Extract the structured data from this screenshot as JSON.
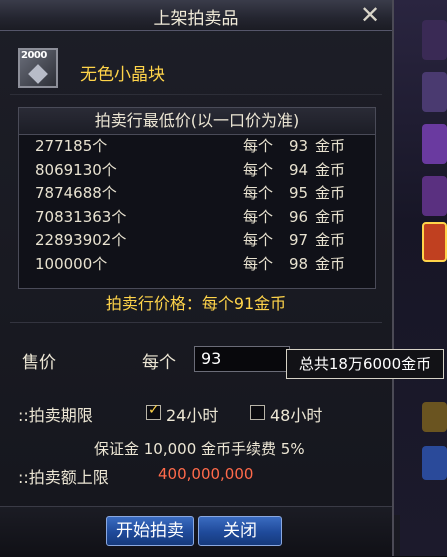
{
  "window": {
    "title": "上架拍卖品",
    "close_glyph": "✕"
  },
  "item": {
    "icon": "crystal-item-icon",
    "badge": "2000",
    "name": "无色小晶块"
  },
  "price_table": {
    "header": "拍卖行最低价(以一口价为准)",
    "rows": [
      {
        "qty": "277185个",
        "per": "每个",
        "price": "93",
        "unit": "金币"
      },
      {
        "qty": "8069130个",
        "per": "每个",
        "price": "94",
        "unit": "金币"
      },
      {
        "qty": "7874688个",
        "per": "每个",
        "price": "95",
        "unit": "金币"
      },
      {
        "qty": "70831363个",
        "per": "每个",
        "price": "96",
        "unit": "金币"
      },
      {
        "qty": "22893902个",
        "per": "每个",
        "price": "97",
        "unit": "金币"
      },
      {
        "qty": "100000个",
        "per": "每个",
        "price": "98",
        "unit": "金币"
      }
    ]
  },
  "market_price": "拍卖行价格：每个91金币",
  "sell": {
    "label": "售价",
    "per_label": "每个",
    "input_value": "93",
    "tooltip": "总共18万6000金币"
  },
  "duration": {
    "label": "::拍卖期限",
    "option_24": "24小时",
    "option_24_checked": true,
    "option_48": "48小时",
    "option_48_checked": false
  },
  "fee_line": "保证金 10,000 金币手续费 5%",
  "limit": {
    "label": "::拍卖额上限",
    "value": "400,000,000"
  },
  "buttons": {
    "start": "开始拍卖",
    "close": "关闭"
  },
  "colors": {
    "accent_gold": "#ffd44a",
    "limit_red": "#ff6a4a",
    "button_blue": "#1f4a9a"
  }
}
